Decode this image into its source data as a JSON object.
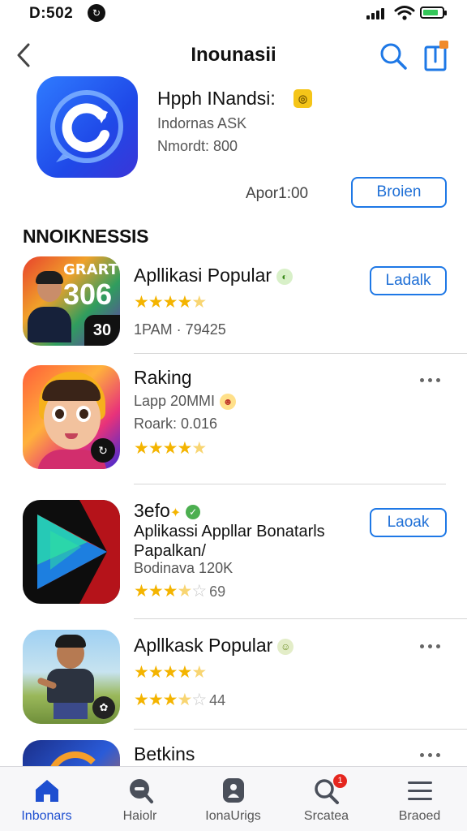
{
  "status_bar": {
    "time": "D:502",
    "indicator": "circle-icon"
  },
  "nav": {
    "title": "Inounasii",
    "back_icon": "chevron-left-icon",
    "search_icon": "search-icon",
    "share_icon": "share-icon"
  },
  "hero": {
    "name": "Ηpph INandsi:",
    "subtitle": "Indornas ASK",
    "meta": "Nmordt: 800",
    "price": "Apor1:00",
    "button": "Broien",
    "icon": "chat-refresh-icon"
  },
  "section_title": "NNOIKNESSIS",
  "apps": [
    {
      "title": "Apllikasi Popular",
      "line1": "1PAM · 79425",
      "rating": 4.5,
      "button": "Ladalk",
      "icon_text_top": "GRART",
      "icon_text_num": "306",
      "icon_text_corner": "30"
    },
    {
      "title": "Raking",
      "line1": "Lapp 20MMI",
      "line2": "Roark: 0.016",
      "rating": 4.5
    },
    {
      "title": "3efo",
      "line1": "Aplikassi  Appllar Bonatarls",
      "line2": "Papalkan/",
      "line3": "Bodinava 120K",
      "rating": 3.5,
      "count": "69",
      "button": "Laoak"
    },
    {
      "title": "Apllkask Popular",
      "rating_a": 4.5,
      "rating_b": 3.5,
      "count": "44"
    },
    {
      "title": "Betkins"
    }
  ],
  "tabs": [
    {
      "label": "Inbonars",
      "icon": "home-icon"
    },
    {
      "label": "Haiolr",
      "icon": "message-search-icon"
    },
    {
      "label": "IonaUrigs",
      "icon": "person-icon"
    },
    {
      "label": "Srcatea",
      "icon": "search-icon",
      "badge": "1"
    },
    {
      "label": "Braoed",
      "icon": "menu-icon"
    }
  ],
  "colors": {
    "accent": "#1e78e6",
    "star": "#f4b400",
    "tab_active": "#1e4fd0",
    "badge": "#e5261f"
  }
}
